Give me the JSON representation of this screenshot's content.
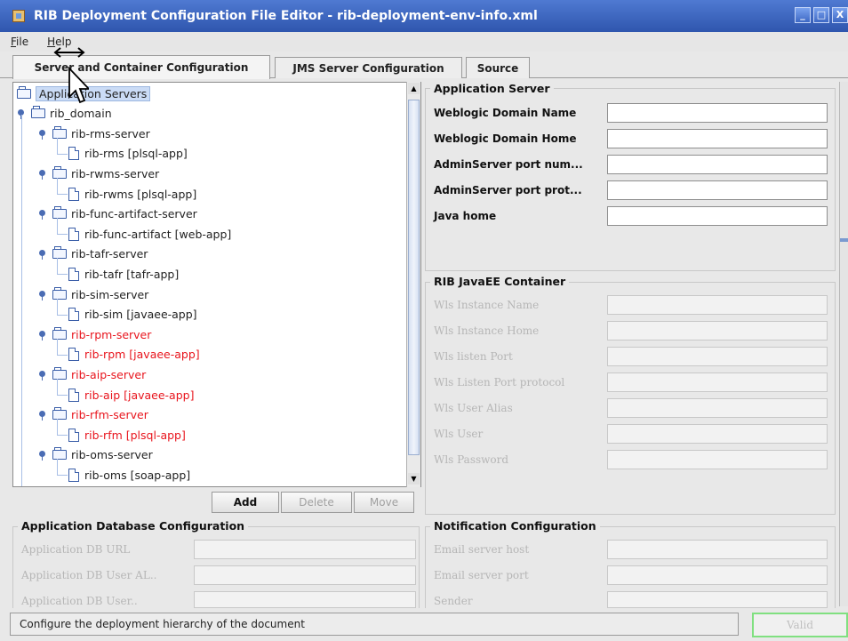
{
  "window": {
    "title": "RIB Deployment Configuration File Editor - rib-deployment-env-info.xml",
    "controls": [
      "_",
      "□",
      "X"
    ]
  },
  "menu": {
    "items": [
      "File",
      "Help"
    ]
  },
  "tabs": [
    {
      "label": "Server and Container Configuration",
      "active": true
    },
    {
      "label": "JMS Server Configuration",
      "active": false
    },
    {
      "label": "Source",
      "active": false
    }
  ],
  "tree": {
    "root": "Application Servers",
    "domain": "rib_domain",
    "servers": [
      {
        "name": "rib-rms-server",
        "app": "rib-rms  [plsql-app]",
        "highlight": false
      },
      {
        "name": "rib-rwms-server",
        "app": "rib-rwms  [plsql-app]",
        "highlight": false
      },
      {
        "name": "rib-func-artifact-server",
        "app": "rib-func-artifact  [web-app]",
        "highlight": false
      },
      {
        "name": "rib-tafr-server",
        "app": "rib-tafr  [tafr-app]",
        "highlight": false
      },
      {
        "name": "rib-sim-server",
        "app": "rib-sim  [javaee-app]",
        "highlight": false
      },
      {
        "name": "rib-rpm-server",
        "app": "rib-rpm  [javaee-app]",
        "highlight": true
      },
      {
        "name": "rib-aip-server",
        "app": "rib-aip  [javaee-app]",
        "highlight": true
      },
      {
        "name": "rib-rfm-server",
        "app": "rib-rfm  [plsql-app]",
        "highlight": true
      },
      {
        "name": "rib-oms-server",
        "app": "rib-oms  [soap-app]",
        "highlight": false
      }
    ]
  },
  "tree_buttons": {
    "add": "Add",
    "delete": "Delete",
    "move": "Move"
  },
  "application_server": {
    "title": "Application Server",
    "fields": [
      {
        "label": "Weblogic Domain Name",
        "value": ""
      },
      {
        "label": "Weblogic Domain Home",
        "value": ""
      },
      {
        "label": "AdminServer port num...",
        "value": ""
      },
      {
        "label": "AdminServer port prot...",
        "value": ""
      },
      {
        "label": "Java home",
        "value": ""
      }
    ]
  },
  "javaee_container": {
    "title": "RIB JavaEE Container",
    "fields": [
      {
        "label": "Wls Instance Name",
        "value": ""
      },
      {
        "label": "Wls Instance Home",
        "value": ""
      },
      {
        "label": "Wls listen Port",
        "value": ""
      },
      {
        "label": "Wls Listen Port protocol",
        "value": ""
      },
      {
        "label": "Wls User Alias",
        "value": ""
      },
      {
        "label": "Wls User",
        "value": ""
      },
      {
        "label": "Wls Password",
        "value": ""
      }
    ]
  },
  "app_db": {
    "title": "Application Database Configuration",
    "fields": [
      {
        "label": "Application DB URL",
        "value": ""
      },
      {
        "label": "Application DB User AL..",
        "value": ""
      },
      {
        "label": "Application DB User..",
        "value": ""
      }
    ]
  },
  "notification": {
    "title": "Notification Configuration",
    "fields": [
      {
        "label": "Email server host",
        "value": ""
      },
      {
        "label": "Email server port",
        "value": ""
      },
      {
        "label": "Sender",
        "value": ""
      }
    ]
  },
  "status": {
    "message": "Configure the deployment hierarchy of the document",
    "valid_label": "Valid"
  },
  "colors": {
    "titlebar": "#3b63bf",
    "highlight_text": "#e8141c",
    "valid_border": "#80e080"
  }
}
